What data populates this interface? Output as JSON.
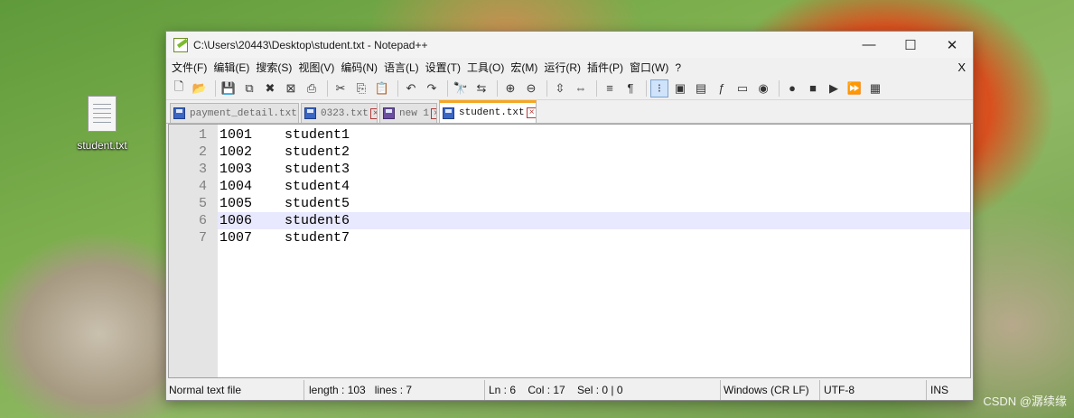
{
  "desktop": {
    "icon_label": "student.txt",
    "icon": "text-file-icon"
  },
  "window": {
    "title": "C:\\Users\\20443\\Desktop\\student.txt - Notepad++",
    "controls": {
      "minimize": "—",
      "maximize": "☐",
      "close": "✕"
    }
  },
  "menu": {
    "items": [
      "文件(F)",
      "编辑(E)",
      "搜索(S)",
      "视图(V)",
      "编码(N)",
      "语言(L)",
      "设置(T)",
      "工具(O)",
      "宏(M)",
      "运行(R)",
      "插件(P)",
      "窗口(W)",
      "?"
    ],
    "close": "X"
  },
  "toolbar": {
    "icons": [
      "new-file-icon",
      "open-file-icon",
      "save-icon",
      "save-all-icon",
      "close-icon",
      "close-all-icon",
      "print-icon",
      "cut-icon",
      "copy-icon",
      "paste-icon",
      "undo-icon",
      "redo-icon",
      "find-icon",
      "replace-icon",
      "zoom-in-icon",
      "zoom-out-icon",
      "sync-vertical-icon",
      "sync-horizontal-icon",
      "word-wrap-icon",
      "show-all-chars-icon",
      "indent-guide-icon",
      "user-lang-icon",
      "doc-map-icon",
      "function-list-icon",
      "folder-workspace-icon",
      "monitoring-icon",
      "record-macro-icon",
      "stop-macro-icon",
      "play-macro-icon",
      "run-macro-multiple-icon",
      "save-macro-icon"
    ],
    "glyphs": [
      "🗋",
      "📂",
      "💾",
      "⧉",
      "✖",
      "⊠",
      "⎙",
      "✂",
      "⎘",
      "📋",
      "↶",
      "↷",
      "🔭",
      "⇆",
      "⊕",
      "⊖",
      "⇳",
      "⇔",
      "≡",
      "¶",
      "⁝",
      "▣",
      "▤",
      "ƒ",
      "▭",
      "◉",
      "●",
      "■",
      "▶",
      "⏩",
      "▦"
    ],
    "active_index": 20
  },
  "tabs": [
    {
      "label": "payment_detail.txt",
      "icon": "saved-file-icon",
      "color": "blue"
    },
    {
      "label": "0323.txt",
      "icon": "saved-file-icon",
      "color": "blue"
    },
    {
      "label": "new 1",
      "icon": "unsaved-file-icon",
      "color": "purple"
    },
    {
      "label": "student.txt",
      "icon": "saved-file-icon",
      "color": "blue",
      "active": true
    }
  ],
  "editor": {
    "current_line": 6,
    "lines": [
      {
        "num": "1",
        "text": "1001    student1"
      },
      {
        "num": "2",
        "text": "1002    student2"
      },
      {
        "num": "3",
        "text": "1003    student3"
      },
      {
        "num": "4",
        "text": "1004    student4"
      },
      {
        "num": "5",
        "text": "1005    student5"
      },
      {
        "num": "6",
        "text": "1006    student6"
      },
      {
        "num": "7",
        "text": "1007    student7"
      }
    ]
  },
  "status": {
    "file_type": "Normal text file",
    "length": "length : 103",
    "lines": "lines : 7",
    "position": "Ln : 6    Col : 17    Sel : 0 | 0",
    "eol": "Windows (CR LF)",
    "encoding": "UTF-8",
    "mode": "INS"
  },
  "watermark": "CSDN @潺续缘"
}
